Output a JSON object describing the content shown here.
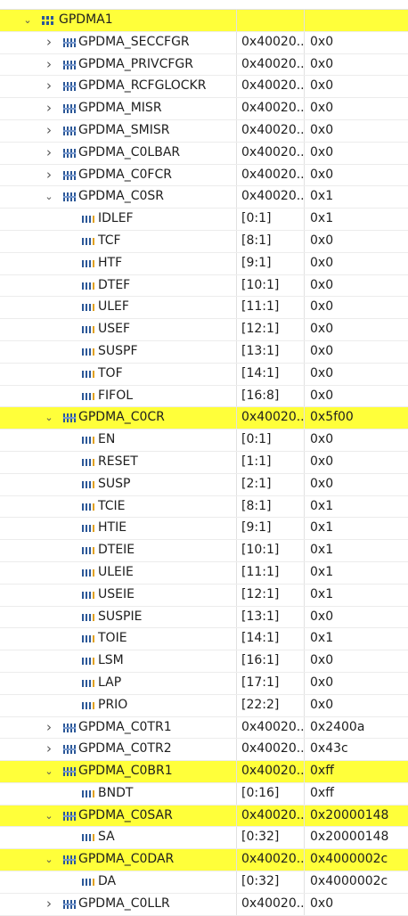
{
  "peripheral": {
    "label": "GPDMA1"
  },
  "rows": [
    {
      "label": "GPDMA_SECCFGR",
      "addr": "0x40020...",
      "value": "0x0",
      "kind": "reg",
      "expanded": false,
      "highlight": false
    },
    {
      "label": "GPDMA_PRIVCFGR",
      "addr": "0x40020...",
      "value": "0x0",
      "kind": "reg",
      "expanded": false,
      "highlight": false
    },
    {
      "label": "GPDMA_RCFGLOCKR",
      "addr": "0x40020...",
      "value": "0x0",
      "kind": "reg",
      "expanded": false,
      "highlight": false
    },
    {
      "label": "GPDMA_MISR",
      "addr": "0x40020...",
      "value": "0x0",
      "kind": "reg",
      "expanded": false,
      "highlight": false
    },
    {
      "label": "GPDMA_SMISR",
      "addr": "0x40020...",
      "value": "0x0",
      "kind": "reg",
      "expanded": false,
      "highlight": false
    },
    {
      "label": "GPDMA_C0LBAR",
      "addr": "0x40020...",
      "value": "0x0",
      "kind": "reg",
      "expanded": false,
      "highlight": false
    },
    {
      "label": "GPDMA_C0FCR",
      "addr": "0x40020...",
      "value": "0x0",
      "kind": "reg",
      "expanded": false,
      "highlight": false
    },
    {
      "label": "GPDMA_C0SR",
      "addr": "0x40020...",
      "value": "0x1",
      "kind": "reg",
      "expanded": true,
      "highlight": false
    },
    {
      "label": "IDLEF",
      "addr": "[0:1]",
      "value": "0x1",
      "kind": "field"
    },
    {
      "label": "TCF",
      "addr": "[8:1]",
      "value": "0x0",
      "kind": "field"
    },
    {
      "label": "HTF",
      "addr": "[9:1]",
      "value": "0x0",
      "kind": "field"
    },
    {
      "label": "DTEF",
      "addr": "[10:1]",
      "value": "0x0",
      "kind": "field"
    },
    {
      "label": "ULEF",
      "addr": "[11:1]",
      "value": "0x0",
      "kind": "field"
    },
    {
      "label": "USEF",
      "addr": "[12:1]",
      "value": "0x0",
      "kind": "field"
    },
    {
      "label": "SUSPF",
      "addr": "[13:1]",
      "value": "0x0",
      "kind": "field"
    },
    {
      "label": "TOF",
      "addr": "[14:1]",
      "value": "0x0",
      "kind": "field"
    },
    {
      "label": "FIFOL",
      "addr": "[16:8]",
      "value": "0x0",
      "kind": "field"
    },
    {
      "label": "GPDMA_C0CR",
      "addr": "0x40020...",
      "value": "0x5f00",
      "kind": "reg",
      "expanded": true,
      "highlight": true
    },
    {
      "label": "EN",
      "addr": "[0:1]",
      "value": "0x0",
      "kind": "field"
    },
    {
      "label": "RESET",
      "addr": "[1:1]",
      "value": "0x0",
      "kind": "field"
    },
    {
      "label": "SUSP",
      "addr": "[2:1]",
      "value": "0x0",
      "kind": "field"
    },
    {
      "label": "TCIE",
      "addr": "[8:1]",
      "value": "0x1",
      "kind": "field"
    },
    {
      "label": "HTIE",
      "addr": "[9:1]",
      "value": "0x1",
      "kind": "field"
    },
    {
      "label": "DTEIE",
      "addr": "[10:1]",
      "value": "0x1",
      "kind": "field"
    },
    {
      "label": "ULEIE",
      "addr": "[11:1]",
      "value": "0x1",
      "kind": "field"
    },
    {
      "label": "USEIE",
      "addr": "[12:1]",
      "value": "0x1",
      "kind": "field"
    },
    {
      "label": "SUSPIE",
      "addr": "[13:1]",
      "value": "0x0",
      "kind": "field"
    },
    {
      "label": "TOIE",
      "addr": "[14:1]",
      "value": "0x1",
      "kind": "field"
    },
    {
      "label": "LSM",
      "addr": "[16:1]",
      "value": "0x0",
      "kind": "field"
    },
    {
      "label": "LAP",
      "addr": "[17:1]",
      "value": "0x0",
      "kind": "field"
    },
    {
      "label": "PRIO",
      "addr": "[22:2]",
      "value": "0x0",
      "kind": "field"
    },
    {
      "label": "GPDMA_C0TR1",
      "addr": "0x40020...",
      "value": "0x2400a",
      "kind": "reg",
      "expanded": false,
      "highlight": false
    },
    {
      "label": "GPDMA_C0TR2",
      "addr": "0x40020...",
      "value": "0x43c",
      "kind": "reg",
      "expanded": false,
      "highlight": false
    },
    {
      "label": "GPDMA_C0BR1",
      "addr": "0x40020...",
      "value": "0xff",
      "kind": "reg",
      "expanded": true,
      "highlight": true
    },
    {
      "label": "BNDT",
      "addr": "[0:16]",
      "value": "0xff",
      "kind": "field"
    },
    {
      "label": "GPDMA_C0SAR",
      "addr": "0x40020...",
      "value": "0x20000148",
      "kind": "reg",
      "expanded": true,
      "highlight": true
    },
    {
      "label": "SA",
      "addr": "[0:32]",
      "value": "0x20000148",
      "kind": "field"
    },
    {
      "label": "GPDMA_C0DAR",
      "addr": "0x40020...",
      "value": "0x4000002c",
      "kind": "reg",
      "expanded": true,
      "highlight": true
    },
    {
      "label": "DA",
      "addr": "[0:32]",
      "value": "0x4000002c",
      "kind": "field"
    },
    {
      "label": "GPDMA_C0LLR",
      "addr": "0x40020...",
      "value": "0x0",
      "kind": "reg",
      "expanded": false,
      "highlight": false
    }
  ],
  "colors": {
    "highlight": "#ffff3a",
    "icon": "#2b5797"
  },
  "icons": {
    "peripheral": "peripheral-icon",
    "register": "register-icon",
    "field": "field-icon",
    "expanded": "chevron-down-icon",
    "collapsed": "chevron-right-icon"
  }
}
